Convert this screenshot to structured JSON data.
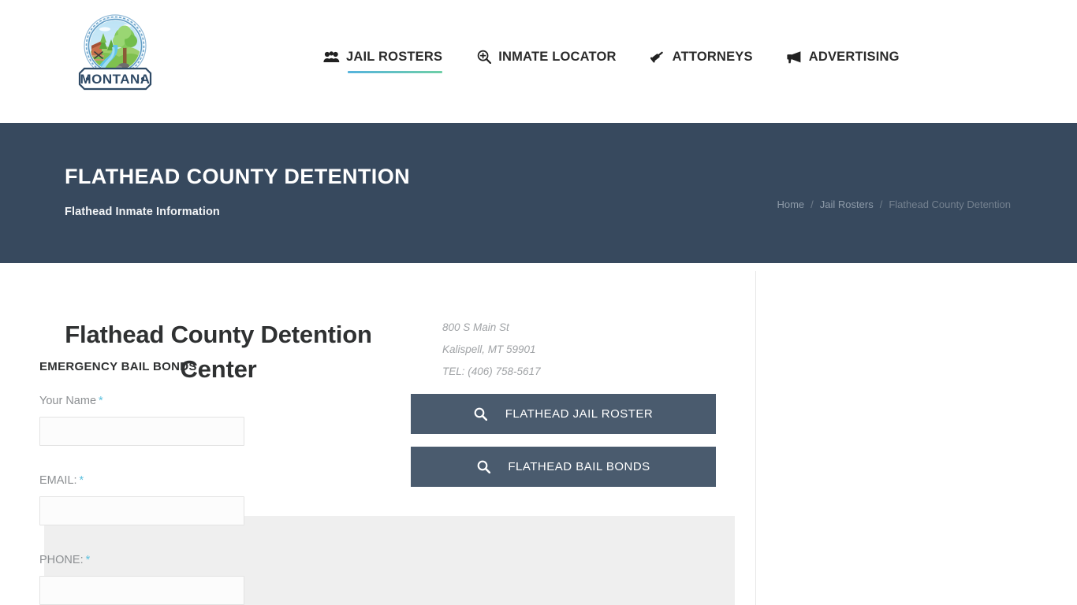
{
  "header": {
    "logo": {
      "icon": "montana-badge-logo",
      "wordmark": "MONTANA"
    },
    "nav": [
      {
        "label": "JAIL ROSTERS",
        "icon": "users-group-icon",
        "active": true
      },
      {
        "label": "INMATE LOCATOR",
        "icon": "search-plus-icon",
        "active": false
      },
      {
        "label": "ATTORNEYS",
        "icon": "gavel-icon",
        "active": false
      },
      {
        "label": "ADVERTISING",
        "icon": "bullhorn-icon",
        "active": false
      }
    ]
  },
  "banner": {
    "title": "FLATHEAD COUNTY DETENTION",
    "subtitle": "Flathead Inmate Information",
    "breadcrumb": [
      {
        "label": "Home",
        "current": false
      },
      {
        "label": "Jail Rosters",
        "current": false
      },
      {
        "label": "Flathead County Detention",
        "current": true
      }
    ],
    "separator": "/"
  },
  "main": {
    "facility_name": "Flathead County Detention Center",
    "address": {
      "street": "800 S Main St",
      "city_state_zip": "Kalispell, MT 59901",
      "phone": "TEL: (406) 758-5617"
    },
    "buttons": [
      {
        "label": "FLATHEAD JAIL ROSTER",
        "icon": "search-icon"
      },
      {
        "label": "FLATHEAD BAIL BONDS",
        "icon": "search-icon"
      }
    ]
  },
  "sidebar": {
    "title": "EMERGENCY BAIL BONDS",
    "fields": [
      {
        "label": "Your Name",
        "required_mark": "*",
        "value": "",
        "placeholder": ""
      },
      {
        "label": "EMAIL:",
        "required_mark": "*",
        "value": "",
        "placeholder": ""
      },
      {
        "label": "PHONE:",
        "required_mark": "*",
        "value": "",
        "placeholder": ""
      }
    ]
  },
  "colors": {
    "banner_bg": "#37495e",
    "button_bg": "#4a5b6e",
    "accent_start": "#55b3dd",
    "accent_end": "#6ecfa6",
    "required_star": "#5bc0de",
    "panel_bg": "#efefef"
  }
}
